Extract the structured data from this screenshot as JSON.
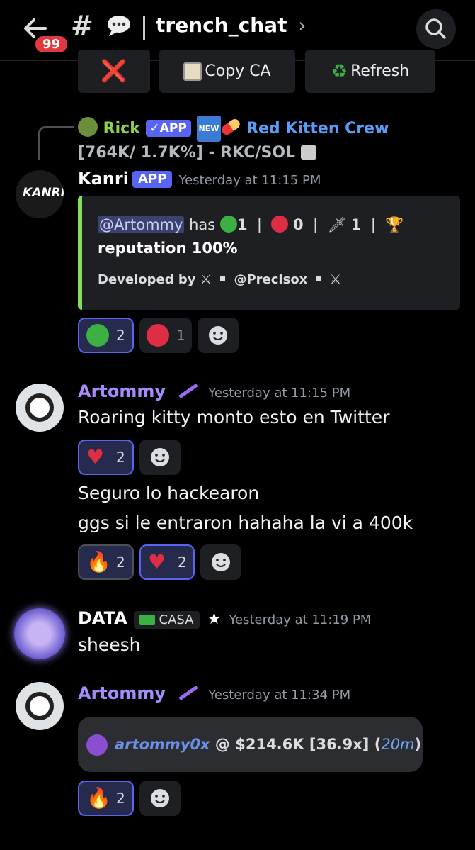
{
  "header": {
    "back_badge": "99",
    "channel_name": "trench_chat",
    "chevron": "›"
  },
  "top_buttons": {
    "cancel": "❌",
    "copy_ca": "Copy CA",
    "refresh": "Refresh"
  },
  "reply": {
    "user": "Rick",
    "app_label": "✓APP",
    "new_label": "NEW",
    "link_text": "Red Kitten Crew",
    "rest": "[764K/ 1.7K%] - RKC/SOL"
  },
  "msg1": {
    "user": "Kanri",
    "app_label": "APP",
    "timestamp": "Yesterday at 11:15 PM",
    "embed": {
      "mention": "@Artommy",
      "has": "has",
      "c_green": "1",
      "c_red": "0",
      "c_dagger": "1",
      "line2": "reputation 100%",
      "dev_prefix": "Developed by",
      "dev_handle": "@Precisox"
    },
    "reactions": {
      "green_count": "2",
      "red_count": "1"
    }
  },
  "msg2": {
    "user": "Artommy",
    "timestamp": "Yesterday at 11:15 PM",
    "text1": "Roaring kitty monto esto en Twitter",
    "react1_count": "2",
    "text2": "Seguro lo hackearon",
    "text3": "ggs si le entraron hahaha la vi a 400k",
    "react2_fire": "2",
    "react2_heart": "2"
  },
  "msg3": {
    "user": "DATA",
    "tag": "CASA",
    "star": "★",
    "timestamp": "Yesterday at 11:19 PM",
    "text": "sheesh"
  },
  "msg4": {
    "user": "Artommy",
    "timestamp": "Yesterday at 11:34 PM",
    "handle": "artommy0x",
    "mid": "@ $214.6K [36.9x] (",
    "time_val": "20m",
    "close": ")",
    "react_fire": "2"
  },
  "colors": {
    "accent": "#5865f2",
    "username_purple": "#a78bfa",
    "embed_border": "#7ee05d",
    "rick_green": "#8fd14f"
  }
}
